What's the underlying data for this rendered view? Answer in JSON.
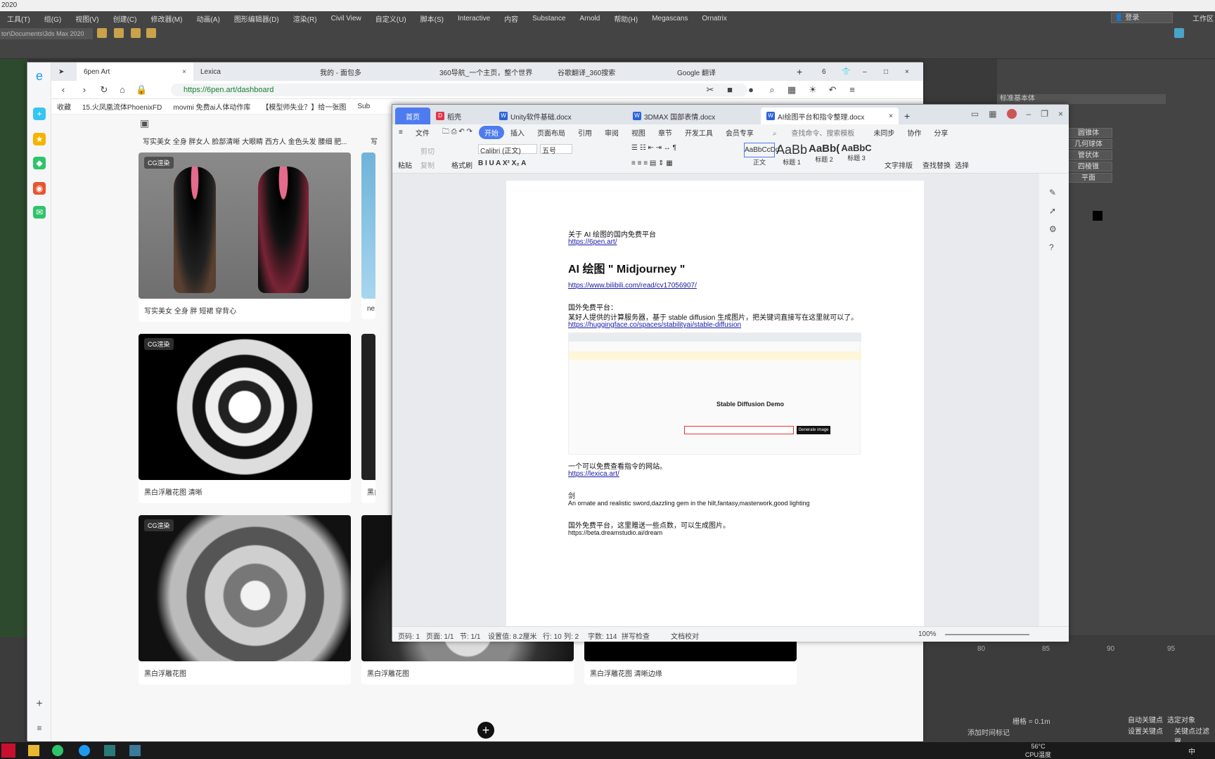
{
  "max": {
    "title": "2020",
    "menu": [
      "工具(T)",
      "组(G)",
      "视图(V)",
      "创建(C)",
      "修改器(M)",
      "动画(A)",
      "图形编辑器(D)",
      "渲染(R)",
      "Civil View",
      "自定义(U)",
      "脚本(S)",
      "Interactive",
      "内容",
      "Substance",
      "Arnold",
      "帮助(H)",
      "Megascans",
      "Ornatrix"
    ],
    "login": "登录",
    "workspace": "工作区",
    "path": "tor\\Documents\\3ds Max 2020",
    "right_label": "标准基本体",
    "right_buttons": [
      "圆锥体",
      "几何球体",
      "管状体",
      "四棱锥",
      "平面"
    ],
    "timeline": [
      "80",
      "85",
      "90",
      "95"
    ],
    "grid": "栅格 = 0.1m",
    "autokey": "自动关键点",
    "setkey": "设置关键点",
    "selected": "选定对象",
    "keyfilter": "关键点过滤器",
    "addtime": "添加时间标记",
    "cpu": "56°C",
    "cpu_label": "CPU温度",
    "ime": "中"
  },
  "browser": {
    "tabs": [
      {
        "label": "6pen Art",
        "active": true
      },
      {
        "label": "Lexica",
        "active": false
      },
      {
        "label": "我的 - 面包多",
        "active": false
      },
      {
        "label": "360导航_一个主页，整个世界",
        "active": false
      },
      {
        "label": "谷歌翻译_360搜索",
        "active": false
      },
      {
        "label": "Google 翻译",
        "active": false
      }
    ],
    "tab_count": "6",
    "url": "https://6pen.art/dashboard",
    "favorites": [
      "收藏",
      "15.火凤凰流体PhoenixFD",
      "movmi 免费ai人体动作库",
      "【模型师失业？】给一张图",
      "Sub"
    ],
    "top_caption_1": "写实美女 全身 胖女人 脸部清晰 大眼睛 西方人 金色头发 腰细 肥...",
    "top_caption_2": "写",
    "cards": [
      {
        "badge": "CG渲染",
        "caption": "写实美女 全身 胖 短裙 穿背心"
      },
      {
        "badge": "",
        "caption": "ne"
      },
      {
        "badge": "CG渲染",
        "caption": "黑白浮雕花图 清晰"
      },
      {
        "badge": "",
        "caption": "黑白"
      },
      {
        "badge": "CG渲染",
        "caption": "黑白浮雕花图"
      },
      {
        "badge": "",
        "caption": "黑白浮雕花图"
      },
      {
        "badge": "",
        "caption": "黑白浮雕花图 清晰边缘"
      }
    ]
  },
  "wps": {
    "tabs": [
      {
        "label": "首页",
        "kind": "home"
      },
      {
        "label": "稻壳",
        "kind": "normal"
      },
      {
        "label": "Unity软件基础.docx",
        "kind": "normal"
      },
      {
        "label": "3DMAX 国部表情.docx",
        "kind": "normal"
      },
      {
        "label": "AI绘图平台和指令整理.docx",
        "kind": "active"
      }
    ],
    "menu": [
      "文件",
      "开始",
      "插入",
      "页面布局",
      "引用",
      "审阅",
      "视图",
      "章节",
      "开发工具",
      "会员专享",
      "查找命令、搜索模板",
      "未同步",
      "协作",
      "分享"
    ],
    "font": "Calibri (正文)",
    "size": "五号",
    "ribbon": {
      "paste": "粘贴",
      "cut": "剪切",
      "copy": "复制",
      "format": "格式刷",
      "text_layout": "文字排版",
      "find": "查找替换",
      "select": "选择"
    },
    "styles": [
      {
        "sample": "AaBbCcDd",
        "name": "正文"
      },
      {
        "sample": "AaBb",
        "name": "标题 1"
      },
      {
        "sample": "AaBb(",
        "name": "标题 2"
      },
      {
        "sample": "AaBbC",
        "name": "标题 3"
      }
    ],
    "doc": {
      "l1": "关于 AI 绘图的国内免费平台",
      "l2": "https://6pen.art/",
      "heading": "AI 绘图 \" Midjourney \"",
      "l3": "https://www.bilibili.com/read/cv17056907/",
      "l4": "国外免费平台：",
      "l5": "某好人提供的计算服务器，基于 stable diffusion 生成图片，把关键词直接写在这里就可以了。",
      "l6": "https://huggingface.co/spaces/stabilityai/stable-diffusion",
      "embed_title": "Stable Diffusion Demo",
      "embed_button": "Generate image",
      "l7": "一个可以免费查看指令的网站。",
      "l8": "https://lexica.art/",
      "l9": "剑",
      "l10": "An ornate and realistic sword,dazzling gem in the hilt,fantasy,masterwork,good lighting",
      "l11": "国外免费平台，这里赠送一些点数，可以生成图片。",
      "l12": "https://beta.dreamstudio.ai/dream"
    },
    "status": {
      "page": "页码: 1",
      "pages": "页面: 1/1",
      "section": "节: 1/1",
      "setting": "设置值: 8.2厘米",
      "row": "行: 10",
      "col": "列: 2",
      "words": "字数: 114",
      "spell": "拼写检查",
      "proof": "文档校对",
      "zoom": "100%"
    }
  }
}
